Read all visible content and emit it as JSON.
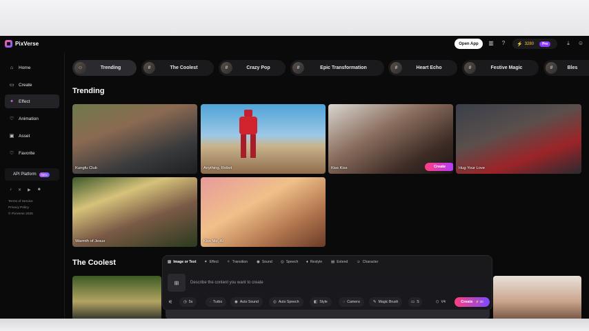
{
  "app": {
    "name": "PixVerse"
  },
  "header": {
    "open_app_label": "Open App",
    "credits": "3280",
    "plan_badge": "Pro",
    "icons": [
      "panel-icon",
      "help-icon",
      "download-icon",
      "user-icon"
    ]
  },
  "sidebar": {
    "items": [
      {
        "label": "Home",
        "icon": "home-icon",
        "active": false
      },
      {
        "label": "Create",
        "icon": "create-icon",
        "active": false
      },
      {
        "label": "Effect",
        "icon": "effect-icon",
        "active": true
      },
      {
        "label": "Animation",
        "icon": "animation-icon",
        "active": false
      },
      {
        "label": "Asset",
        "icon": "asset-icon",
        "active": false
      },
      {
        "label": "Favorite",
        "icon": "favorite-icon",
        "active": false
      }
    ],
    "api_label": "API Platform",
    "api_badge": "New",
    "socials": [
      "tiktok-icon",
      "x-icon",
      "youtube-icon",
      "discord-icon"
    ],
    "legal": [
      "Terms of Service",
      "Privacy Policy",
      "© PixVerse 2025"
    ]
  },
  "tabs": [
    {
      "label": "Trending",
      "active": true
    },
    {
      "label": "The Coolest",
      "active": false
    },
    {
      "label": "Crazy Pop",
      "active": false
    },
    {
      "label": "Epic Transformation",
      "active": false
    },
    {
      "label": "Heart Echo",
      "active": false
    },
    {
      "label": "Festive Magic",
      "active": false
    },
    {
      "label": "Bles",
      "active": false
    }
  ],
  "sections": {
    "trending_title": "Trending",
    "coolest_title": "The Coolest"
  },
  "trending_cards": [
    {
      "label": "Kungfu Club"
    },
    {
      "label": "Anything, Robot"
    },
    {
      "label": "Kiss Kiss",
      "action": "Create"
    },
    {
      "label": "Hug Your Love"
    },
    {
      "label": "Warmth of Jesus"
    },
    {
      "label": "Kiss Me, AI"
    }
  ],
  "prompt": {
    "tabs": [
      {
        "label": "Image or Text",
        "icon": "image-icon",
        "active": true
      },
      {
        "label": "Effect",
        "icon": "effect-icon",
        "active": false
      },
      {
        "label": "Transition",
        "icon": "transition-icon",
        "active": false
      },
      {
        "label": "Sound",
        "icon": "sound-icon",
        "active": false
      },
      {
        "label": "Speech",
        "icon": "speech-icon",
        "active": false
      },
      {
        "label": "Restyle",
        "icon": "restyle-icon",
        "active": false
      },
      {
        "label": "Extend",
        "icon": "extend-icon",
        "active": false
      },
      {
        "label": "Character",
        "icon": "character-icon",
        "active": false
      }
    ],
    "placeholder": "Describe the content you want to create",
    "chips": [
      {
        "label": "5s",
        "icon": "clock-icon"
      },
      {
        "label": "Turbo",
        "icon": "turbo-icon"
      },
      {
        "label": "Auto Sound",
        "icon": "sound-icon"
      },
      {
        "label": "Auto Speech",
        "icon": "speech-icon"
      },
      {
        "label": "Style",
        "icon": "style-icon"
      },
      {
        "label": "Camera",
        "icon": "camera-icon"
      },
      {
        "label": "Magic Brush",
        "icon": "brush-icon"
      },
      {
        "label": "S",
        "icon": "more-icon"
      }
    ],
    "version": "V4",
    "create_label": "Create",
    "create_cost": "30"
  }
}
